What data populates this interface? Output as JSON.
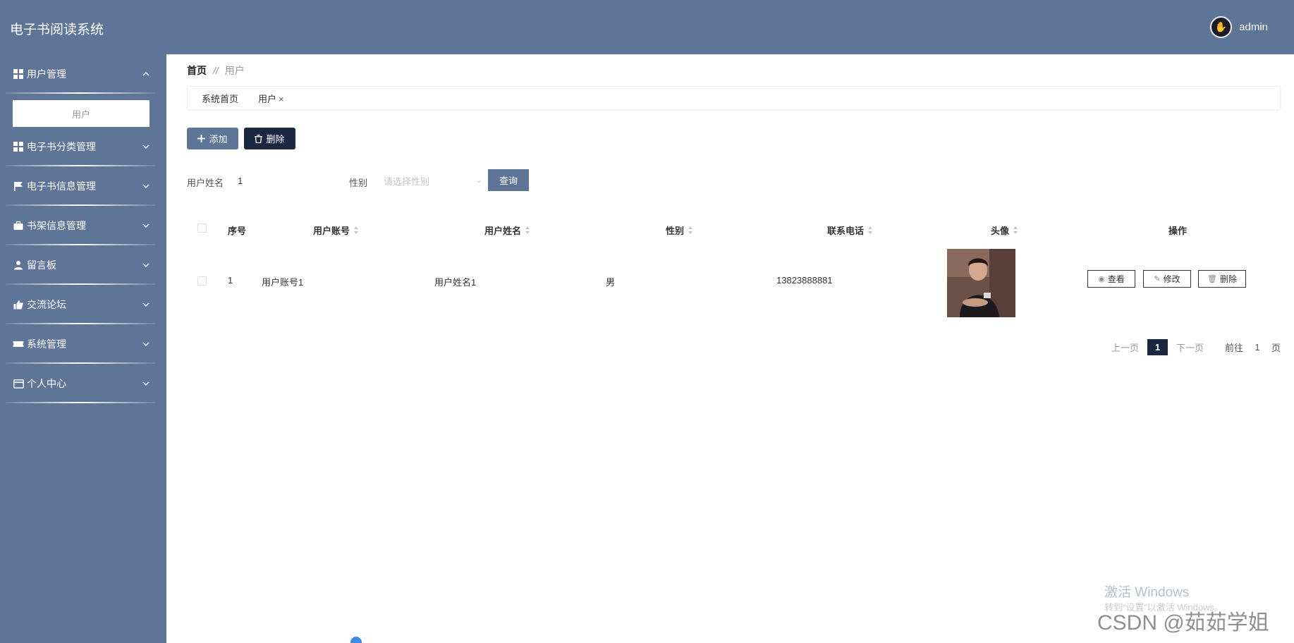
{
  "header": {
    "app_title": "电子书阅读系统",
    "username": "admin"
  },
  "sidebar": {
    "items": [
      {
        "label": "用户管理",
        "icon": "grid-icon",
        "expanded": true,
        "sub": [
          "用户"
        ]
      },
      {
        "label": "电子书分类管理",
        "icon": "grid-icon"
      },
      {
        "label": "电子书信息管理",
        "icon": "flag-icon"
      },
      {
        "label": "书架信息管理",
        "icon": "briefcase-icon"
      },
      {
        "label": "留言板",
        "icon": "user-icon"
      },
      {
        "label": "交流论坛",
        "icon": "thumbs-up-icon"
      },
      {
        "label": "系统管理",
        "icon": "ticket-icon"
      },
      {
        "label": "个人中心",
        "icon": "card-icon"
      }
    ]
  },
  "breadcrumb": {
    "home": "首页",
    "separator": "//",
    "current": "用户"
  },
  "tabs": [
    {
      "label": "系统首页"
    },
    {
      "label": "用户",
      "close": "×"
    }
  ],
  "toolbar": {
    "add_label": "添加",
    "delete_label": "删除"
  },
  "search": {
    "name_label": "用户姓名",
    "name_value": "1",
    "gender_label": "性别",
    "gender_placeholder": "请选择性别",
    "query_label": "查询"
  },
  "table": {
    "columns": [
      "序号",
      "用户账号",
      "用户姓名",
      "性别",
      "联系电话",
      "头像",
      "操作"
    ],
    "rows": [
      {
        "index": "1",
        "account": "用户账号1",
        "name": "用户姓名1",
        "gender": "男",
        "phone": "13823888881",
        "actions": {
          "view": "查看",
          "edit": "修改",
          "delete": "删除"
        }
      }
    ]
  },
  "pagination": {
    "prev": "上一页",
    "current": "1",
    "next": "下一页",
    "goto_label": "前往",
    "goto_value": "1",
    "page_unit": "页"
  },
  "watermark": {
    "windows_line1": "激活 Windows",
    "windows_line2": "转到“设置”以激活 Windows。",
    "csdn": "CSDN @茹茹学姐"
  },
  "colors": {
    "primary": "#5f7598",
    "dark": "#1b2640"
  }
}
